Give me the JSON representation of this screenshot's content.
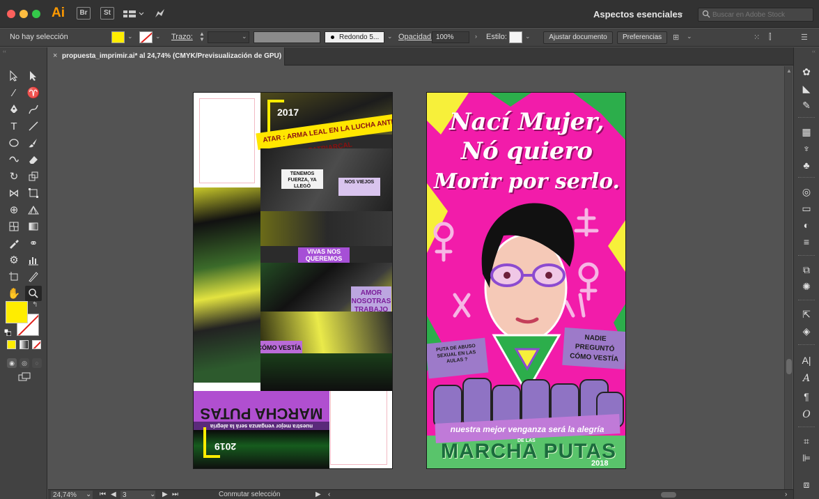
{
  "appbar": {
    "logo": "Ai",
    "bridge": "Br",
    "stock": "St",
    "workspace": "Aspectos esenciales",
    "search_placeholder": "Buscar en Adobe Stock"
  },
  "control_bar": {
    "selection_label": "No hay selección",
    "stroke_label": "Trazo:",
    "brush_value": "Redondo 5...",
    "opacity_label": "Opacidad:",
    "opacity_value": "100%",
    "style_label": "Estilo:",
    "fit_document_button": "Ajustar documento",
    "preferences_button": "Preferencias"
  },
  "document_tab": {
    "title": "propuesta_imprimir.ai* al 24,74% (CMYK/Previsualización de GPU)"
  },
  "artboard_left": {
    "year_top": "2017",
    "year_bottom": "2019",
    "banner_1": "ATAR : ARMA LEAL EN LA LUCHA ANTI PATRIARCAL",
    "sign_1": "TENEMOS FUERZA, YA LLEGÓ",
    "sign_2": "NOS VIEJOS",
    "sign_3": "NADIE PREGUNTÓ CÓMO VESTÍA EL VIOLADOR",
    "sign_4": "AMOR NOSOTRAS TRABAJO NO PAGO",
    "sign_5": "VIVAS NOS QUEREMOS",
    "banner_march": "MARCHA PUTAS",
    "banner_sub": "nuestra mejor venganza será la alegría"
  },
  "artboard_right": {
    "title_line_1": "Nací Mujer,",
    "title_line_2": "Nó quiero",
    "title_line_3": "Morir por serlo.",
    "sign_left": "PUTA DE ABUSO SEXUAL EN LAS AULAS ?",
    "sign_right": "NADIE PREGUNTÓ CÓMO VESTÍA",
    "footer_slogan": "nuestra mejor venganza será la alegría",
    "brand": "MARCHA PUTAS",
    "brand_small": "DE LAS",
    "year": "2018"
  },
  "status_bar": {
    "zoom": "24,74%",
    "artboard_number": "3",
    "mode_label": "Conmutar selección"
  },
  "colors": {
    "fill": "#ffed00",
    "stroke_none": "#e0201b",
    "poster_bg": "#f21caa",
    "accent_green": "#1b6b3d",
    "accent_purple": "#b04fd0"
  }
}
